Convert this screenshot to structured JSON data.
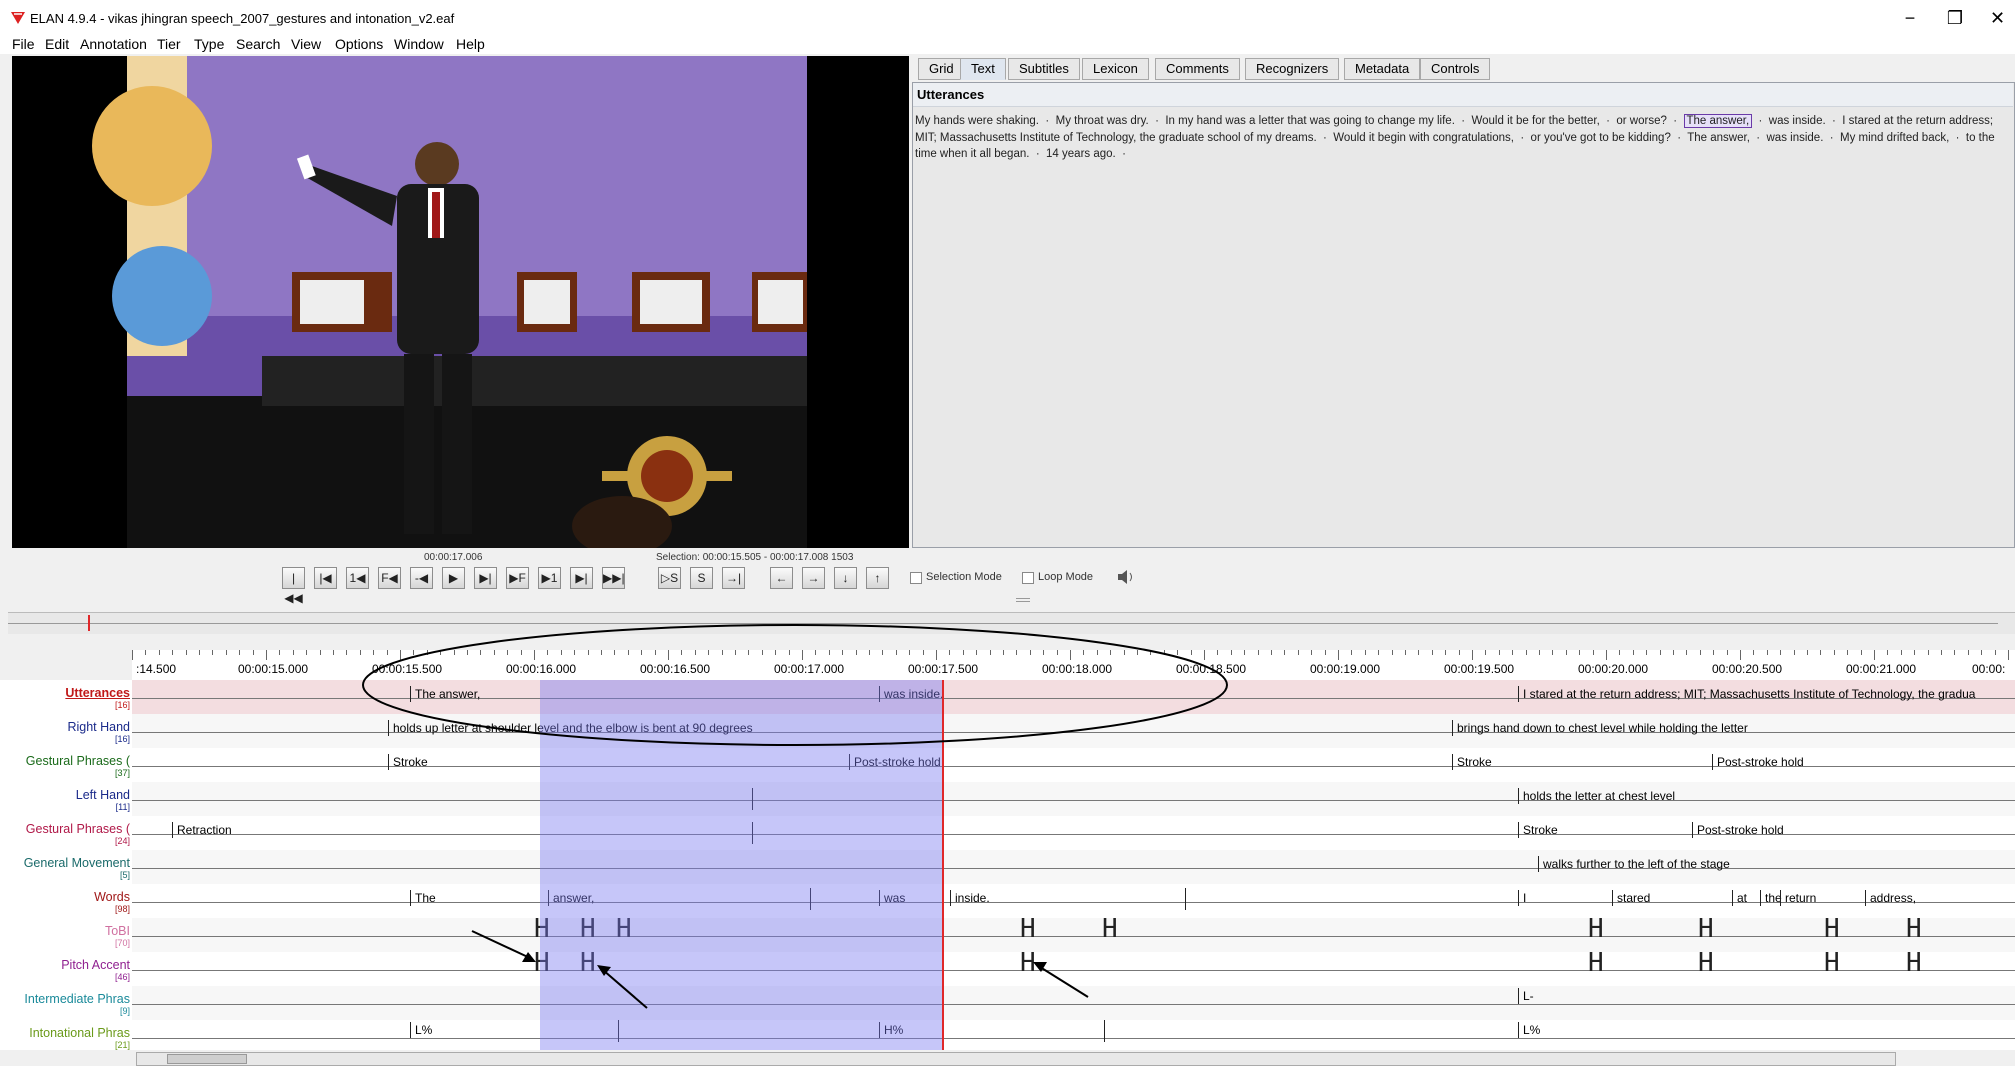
{
  "window": {
    "title": "ELAN 4.9.4 - vikas jhingran speech_2007_gestures and intonation_v2.eaf",
    "minimize": "−",
    "restore": "❐",
    "close": "✕"
  },
  "menu": [
    "File",
    "Edit",
    "Annotation",
    "Tier",
    "Type",
    "Search",
    "View",
    "Options",
    "Window",
    "Help"
  ],
  "tabs": [
    "Grid",
    "Text",
    "Subtitles",
    "Lexicon",
    "Comments",
    "Recognizers",
    "Metadata",
    "Controls"
  ],
  "active_tab": "Text",
  "text_view": {
    "tier": "Utterances",
    "before": "My hands were shaking.  ·  My throat was dry.  ·  In my hand was a letter that was going to change my life.  ·  Would it be for the better,  ·  or worse?  ·  ",
    "selected": "The answer,",
    "after": "  ·  was inside.  ·  I stared at the return address; MIT; Massachusetts Institute of Technology, the graduate school of my dreams.  ·  Would it begin with congratulations,  ·  or you've got to be kidding?  ·  The answer,  ·  was inside.  ·  My mind drifted back,  ·  to the time when it all began.  ·  14 years ago.  ·"
  },
  "media": {
    "current_time": "00:00:17.006",
    "selection": "Selection: 00:00:15.505 - 00:00:17.008  1503",
    "selection_mode": "Selection Mode",
    "loop_mode": "Loop Mode"
  },
  "transport_buttons": [
    "|◀◀",
    "|◀",
    "1◀",
    "F◀",
    "-◀",
    "▶",
    "▶|",
    "▶F",
    "▶1",
    "▶|",
    "▶▶|"
  ],
  "selection_buttons": [
    "▷S",
    "S",
    "→|"
  ],
  "nav_buttons": [
    "←",
    "→",
    "↓",
    "↑"
  ],
  "ruler": [
    ":14.500",
    "00:00:15.000",
    "00:00:15.500",
    "00:00:16.000",
    "00:00:16.500",
    "00:00:17.000",
    "00:00:17.500",
    "00:00:18.000",
    "00:00:18.500",
    "00:00:19.000",
    "00:00:19.500",
    "00:00:20.000",
    "00:00:20.500",
    "00:00:21.000",
    "00:00:"
  ],
  "tiers": [
    {
      "name": "Utterances",
      "count": "[16]",
      "color": "#c01818"
    },
    {
      "name": "Right Hand",
      "count": "[16]",
      "color": "#1a2a8a"
    },
    {
      "name": "Gestural Phrases (",
      "count": "[37]",
      "color": "#1a6a1a"
    },
    {
      "name": "Left Hand",
      "count": "[11]",
      "color": "#1a2a8a"
    },
    {
      "name": "Gestural Phrases (",
      "count": "[24]",
      "color": "#b01848"
    },
    {
      "name": "General Movement",
      "count": "[5]",
      "color": "#1a6a6a"
    },
    {
      "name": "Words",
      "count": "[98]",
      "color": "#a01818"
    },
    {
      "name": "ToBI",
      "count": "[70]",
      "color": "#d070a0"
    },
    {
      "name": "Pitch Accent",
      "count": "[46]",
      "color": "#902090"
    },
    {
      "name": "Intermediate Phras",
      "count": "[9]",
      "color": "#1a8a9a"
    },
    {
      "name": "Intonational Phras",
      "count": "[21]",
      "color": "#6a9a1a"
    }
  ],
  "annotations": {
    "utt": [
      "The answer,",
      "was inside.",
      "I stared at the return address; MIT; Massachusetts Institute of Technology, the gradua"
    ],
    "right_hand": [
      "holds up letter at shoulder level and the elbow is bent at 90 degrees",
      "brings hand down to chest level while holding the letter"
    ],
    "gp1": [
      "Stroke",
      "Post-stroke hold",
      "Stroke",
      "Post-stroke hold"
    ],
    "left_hand": [
      "holds the letter at chest level"
    ],
    "gp2": [
      "Retraction",
      "Stroke",
      "Post-stroke hold"
    ],
    "movement": [
      "walks further to the left of the stage"
    ],
    "words": [
      "The",
      "answer,",
      "was",
      "inside.",
      "I",
      "stared",
      "at",
      "the",
      "return",
      "address,"
    ],
    "intermediate": [
      "L-"
    ],
    "intonational": [
      "L%",
      "H%",
      "L%"
    ]
  }
}
